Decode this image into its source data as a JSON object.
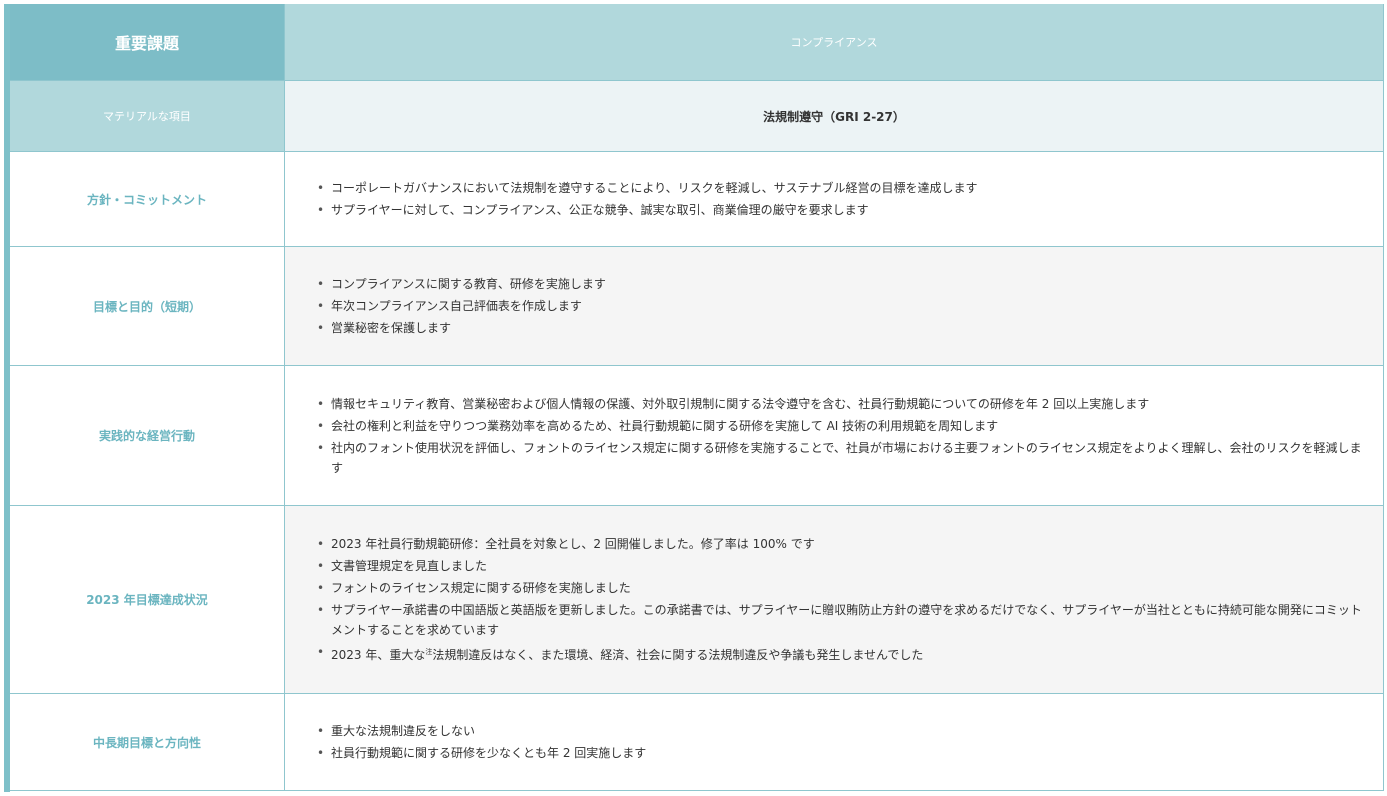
{
  "header": {
    "left": "重要課題",
    "right": "コンプライアンス"
  },
  "material": {
    "label": "マテリアルな項目",
    "value": "法規制遵守（GRI 2-27）"
  },
  "rows": [
    {
      "label": "方針・コミットメント",
      "items": [
        "コーポレートガバナンスにおいて法規制を遵守することにより、リスクを軽減し、サステナブル経営の目標を達成します",
        "サプライヤーに対して、コンプライアンス、公正な競争、誠実な取引、商業倫理の厳守を要求します"
      ]
    },
    {
      "label": "目標と目的（短期）",
      "items": [
        "コンプライアンスに関する教育、研修を実施します",
        "年次コンプライアンス自己評価表を作成します",
        "営業秘密を保護します"
      ]
    },
    {
      "label": "実践的な経営行動",
      "items": [
        "情報セキュリティ教育、営業秘密および個人情報の保護、対外取引規制に関する法令遵守を含む、社員行動規範についての研修を年 2 回以上実施します",
        "会社の権利と利益を守りつつ業務効率を高めるため、社員行動規範に関する研修を実施して AI 技術の利用規範を周知します",
        "社内のフォント使用状況を評価し、フォントのライセンス規定に関する研修を実施することで、社員が市場における主要フォントのライセンス規定をよりよく理解し、会社のリスクを軽減します"
      ]
    },
    {
      "label": "2023 年目標達成状況",
      "items": [
        "2023 年社員行動規範研修：全社員を対象とし、2 回開催しました。修了率は 100% です",
        "文書管理規定を見直しました",
        "フォントのライセンス規定に関する研修を実施しました",
        "サプライヤー承諾書の中国語版と英語版を更新しました。この承諾書では、サプライヤーに贈収賄防止方針の遵守を求めるだけでなく、サプライヤーが当社とともに持続可能な開発にコミットメントすることを求めています"
      ],
      "note_item": {
        "before": "2023 年、重大な",
        "sup": "注",
        "after": "法規制違反はなく、また環境、経済、社会に関する法規制違反や争議も発生しませんでした"
      }
    },
    {
      "label": "中長期目標と方向性",
      "items": [
        "重大な法規制違反をしない",
        "社員行動規範に関する研修を少なくとも年 2 回実施します"
      ]
    }
  ]
}
